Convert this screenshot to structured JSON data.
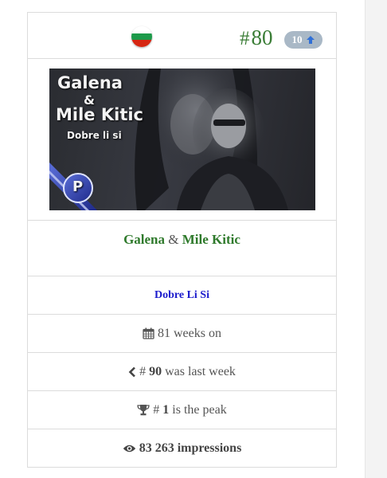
{
  "header": {
    "rank": "80",
    "rank_prefix": "#",
    "change": "10",
    "flag_colors": [
      "#ffffff",
      "#1d9a4a",
      "#d62612"
    ]
  },
  "cover": {
    "artist_line1": "Galena",
    "artist_line2": "&",
    "artist_line3": "Mile Kitic",
    "song": "Dobre li si",
    "badge_letter": "P"
  },
  "track": {
    "artist_a": "Galena",
    "joiner": "&",
    "artist_b": "Mile Kitic",
    "song": "Dobre Li Si"
  },
  "stats": {
    "weeks": "81 weeks on",
    "last_week_prefix": "#",
    "last_week_num": "90",
    "last_week_suffix": "was last week",
    "peak_prefix": "#",
    "peak_num": "1",
    "peak_suffix": "is the peak",
    "impressions": "83 263 impressions"
  },
  "colors": {
    "rank_green": "#3a7d36",
    "artist_green": "#2f7a2c",
    "song_blue": "#1a1acc",
    "badge_bg": "#a9b8c6"
  },
  "icons": [
    "calendar-icon",
    "chevron-left-icon",
    "trophy-icon",
    "eye-icon",
    "arrow-up-icon"
  ]
}
